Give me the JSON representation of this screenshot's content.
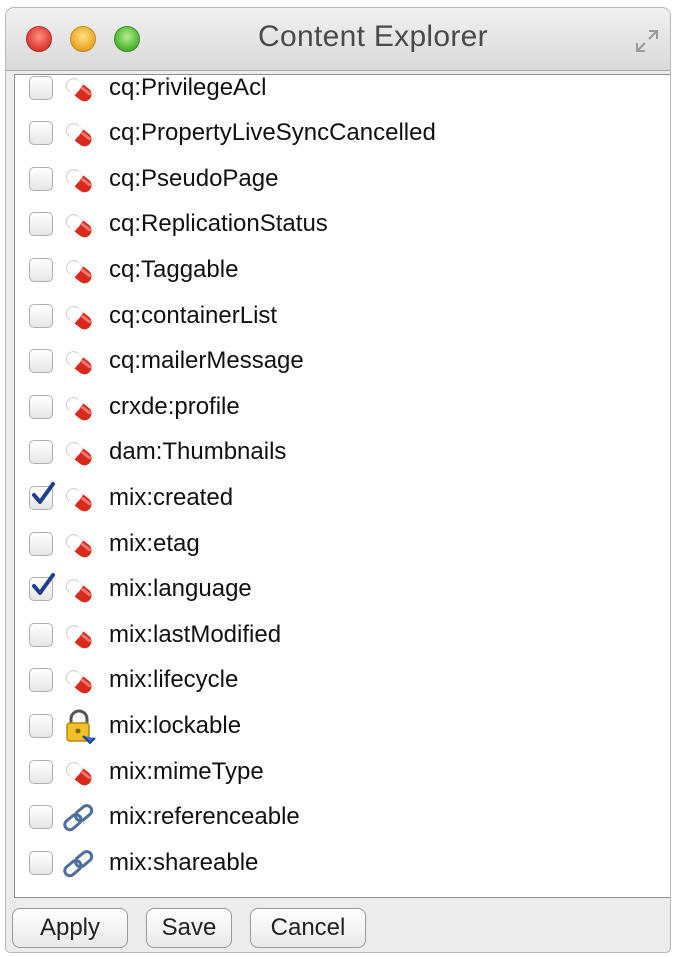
{
  "window": {
    "title": "Content Explorer"
  },
  "node_types": [
    {
      "label": "cq:PrivilegeAcl",
      "checked": false,
      "icon": "pill-icon"
    },
    {
      "label": "cq:PropertyLiveSyncCancelled",
      "checked": false,
      "icon": "pill-icon"
    },
    {
      "label": "cq:PseudoPage",
      "checked": false,
      "icon": "pill-icon"
    },
    {
      "label": "cq:ReplicationStatus",
      "checked": false,
      "icon": "pill-icon"
    },
    {
      "label": "cq:Taggable",
      "checked": false,
      "icon": "pill-icon"
    },
    {
      "label": "cq:containerList",
      "checked": false,
      "icon": "pill-icon"
    },
    {
      "label": "cq:mailerMessage",
      "checked": false,
      "icon": "pill-icon"
    },
    {
      "label": "crxde:profile",
      "checked": false,
      "icon": "pill-icon"
    },
    {
      "label": "dam:Thumbnails",
      "checked": false,
      "icon": "pill-icon"
    },
    {
      "label": "mix:created",
      "checked": true,
      "icon": "pill-icon"
    },
    {
      "label": "mix:etag",
      "checked": false,
      "icon": "pill-icon"
    },
    {
      "label": "mix:language",
      "checked": true,
      "icon": "pill-icon"
    },
    {
      "label": "mix:lastModified",
      "checked": false,
      "icon": "pill-icon"
    },
    {
      "label": "mix:lifecycle",
      "checked": false,
      "icon": "pill-icon"
    },
    {
      "label": "mix:lockable",
      "checked": false,
      "icon": "lock-icon"
    },
    {
      "label": "mix:mimeType",
      "checked": false,
      "icon": "pill-icon"
    },
    {
      "label": "mix:referenceable",
      "checked": false,
      "icon": "link-icon"
    },
    {
      "label": "mix:shareable",
      "checked": false,
      "icon": "link-icon"
    }
  ],
  "buttons": {
    "apply": "Apply",
    "save": "Save",
    "cancel": "Cancel"
  },
  "colors": {
    "pill_red": "#d9291c",
    "check_blue": "#1f3f8f"
  }
}
